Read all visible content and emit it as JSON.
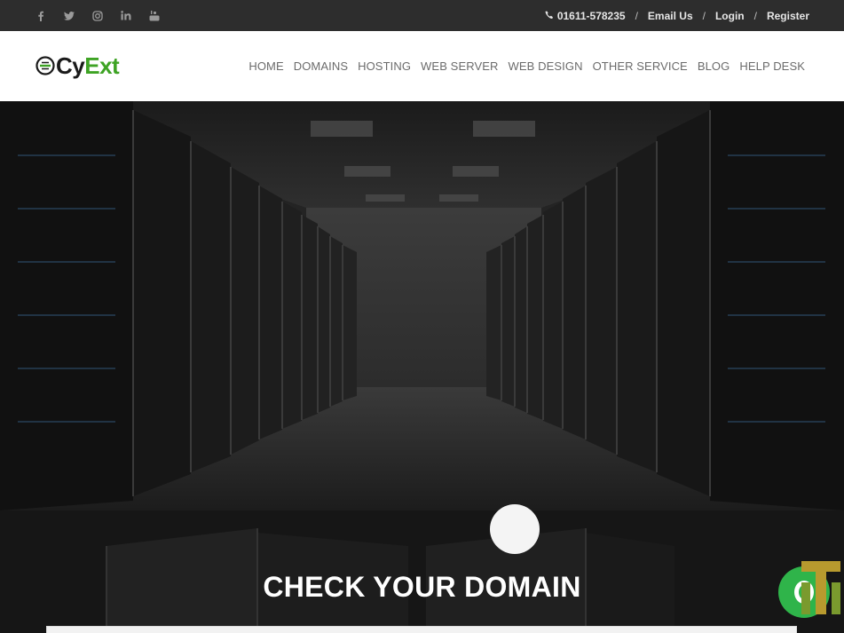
{
  "topbar": {
    "social": [
      "facebook-icon",
      "twitter-icon",
      "instagram-icon",
      "linkedin-icon",
      "youtube-icon"
    ],
    "phone": "01611-578235",
    "email_label": "Email Us",
    "login_label": "Login",
    "register_label": "Register",
    "separator": "/"
  },
  "header": {
    "logo_part1": "Cy",
    "logo_part2": "Ext",
    "nav": [
      "HOME",
      "DOMAINS",
      "HOSTING",
      "WEB SERVER",
      "WEB DESIGN",
      "OTHER SERVICE",
      "BLOG",
      "HELP DESK"
    ]
  },
  "domain": {
    "title": "CHECK YOUR DOMAIN"
  },
  "colors": {
    "brand_green": "#3ea324",
    "topbar_bg": "#2d2d2d",
    "chat_green": "#2fb44a"
  }
}
